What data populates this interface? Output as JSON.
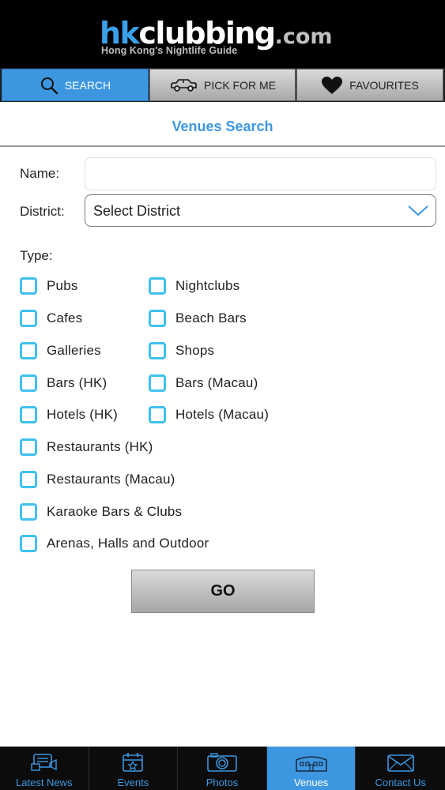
{
  "header": {
    "logo": {
      "hk": "hk",
      "clubbing": "clubbing",
      "com": ".com",
      "tagline": "Hong Kong's Nightlife Guide"
    }
  },
  "tabs": [
    {
      "label": "SEARCH",
      "icon": "search-icon",
      "active": true
    },
    {
      "label": "PICK FOR ME",
      "icon": "car-icon",
      "active": false
    },
    {
      "label": "FAVOURITES",
      "icon": "heart-icon",
      "active": false
    }
  ],
  "page": {
    "title": "Venues Search"
  },
  "form": {
    "name_label": "Name:",
    "name_value": "",
    "district_label": "District:",
    "district_value": "Select District",
    "type_label": "Type:",
    "types": [
      "Pubs",
      "Nightclubs",
      "Cafes",
      "Beach Bars",
      "Galleries",
      "Shops",
      "Bars (HK)",
      "Bars (Macau)",
      "Hotels (HK)",
      "Hotels (Macau)",
      "Restaurants (HK)",
      "Restaurants (Macau)",
      "Karaoke Bars & Clubs",
      "Arenas, Halls and Outdoor"
    ],
    "go_label": "GO"
  },
  "bottom_nav": [
    {
      "label": "Latest News",
      "icon": "news-icon",
      "active": false
    },
    {
      "label": "Events",
      "icon": "calendar-icon",
      "active": false
    },
    {
      "label": "Photos",
      "icon": "camera-icon",
      "active": false
    },
    {
      "label": "Venues",
      "icon": "building-icon",
      "active": true
    },
    {
      "label": "Contact Us",
      "icon": "mail-icon",
      "active": false
    }
  ],
  "colors": {
    "accent": "#3d97e0",
    "checkbox": "#3fc1ee",
    "header_bg": "#000000"
  }
}
